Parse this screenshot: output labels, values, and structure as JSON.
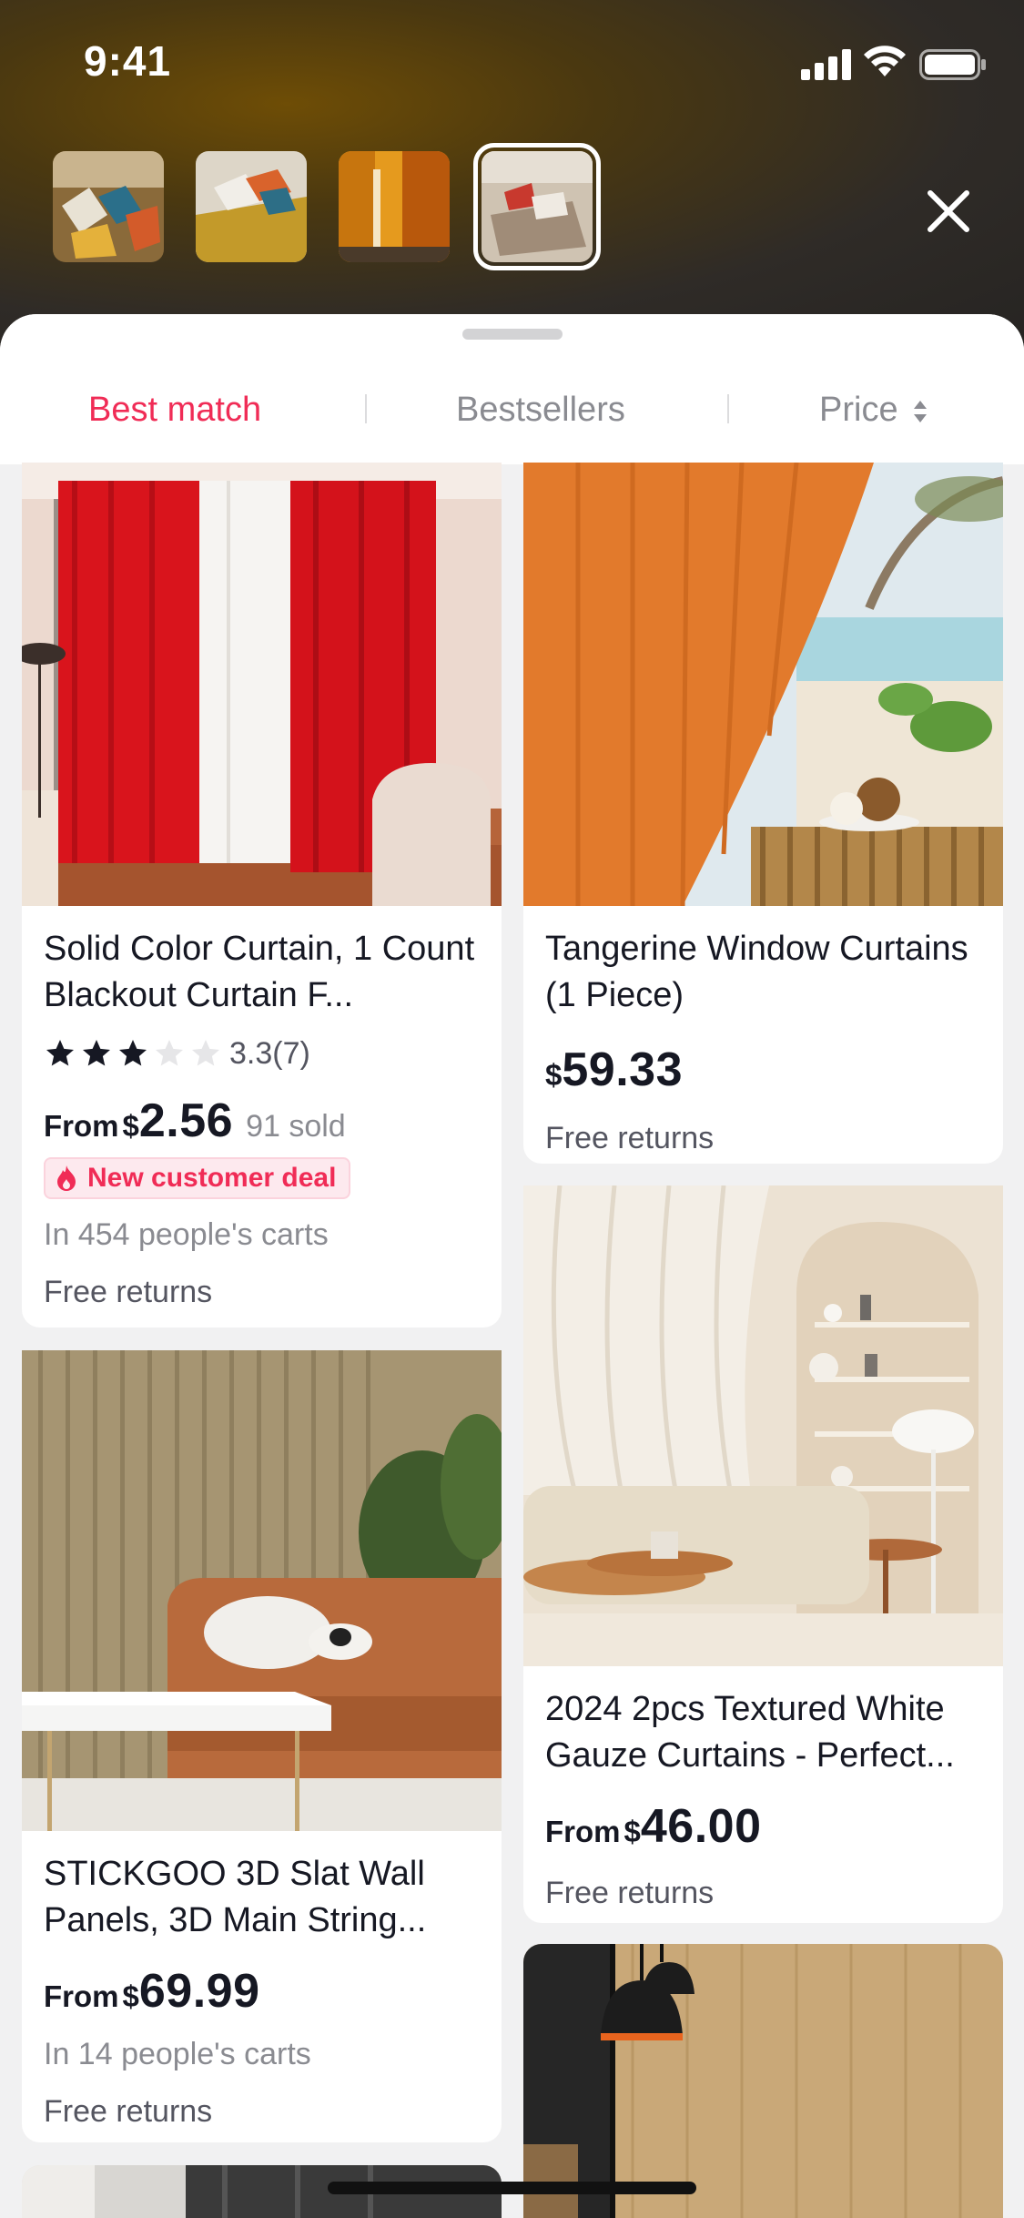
{
  "status_bar": {
    "time": "9:41"
  },
  "thumbnails": [
    {
      "name": "thumb-1"
    },
    {
      "name": "thumb-2"
    },
    {
      "name": "thumb-3"
    },
    {
      "name": "thumb-4",
      "selected": true
    }
  ],
  "tabs": [
    {
      "label": "Best match",
      "active": true
    },
    {
      "label": "Bestsellers",
      "active": false
    },
    {
      "label": "Price",
      "active": false,
      "icon": "sort-arrows-icon"
    }
  ],
  "products": [
    {
      "title": "Solid Color Curtain, 1 Count Blackout Curtain F...",
      "rating": "3.3",
      "rating_count": "(7)",
      "stars_filled": 3,
      "from_label": "From",
      "currency": "$",
      "price": "2.56",
      "sold": "91 sold",
      "deal": "New customer deal",
      "carts": "In 454 people's carts",
      "returns": "Free returns"
    },
    {
      "title": "Tangerine Window Curtains (1 Piece)",
      "currency": "$",
      "price": "59.33",
      "returns": "Free returns"
    },
    {
      "title": "STICKGOO 3D Slat Wall Panels, 3D Main String...",
      "from_label": "From",
      "currency": "$",
      "price": "69.99",
      "carts": "In 14 people's carts",
      "returns": "Free returns"
    },
    {
      "title": "2024 2pcs Textured White Gauze Curtains - Perfect...",
      "from_label": "From",
      "currency": "$",
      "price": "46.00",
      "returns": "Free returns"
    }
  ],
  "colors": {
    "accent": "#f02c56",
    "muted": "#8a8b91",
    "text": "#161823"
  }
}
